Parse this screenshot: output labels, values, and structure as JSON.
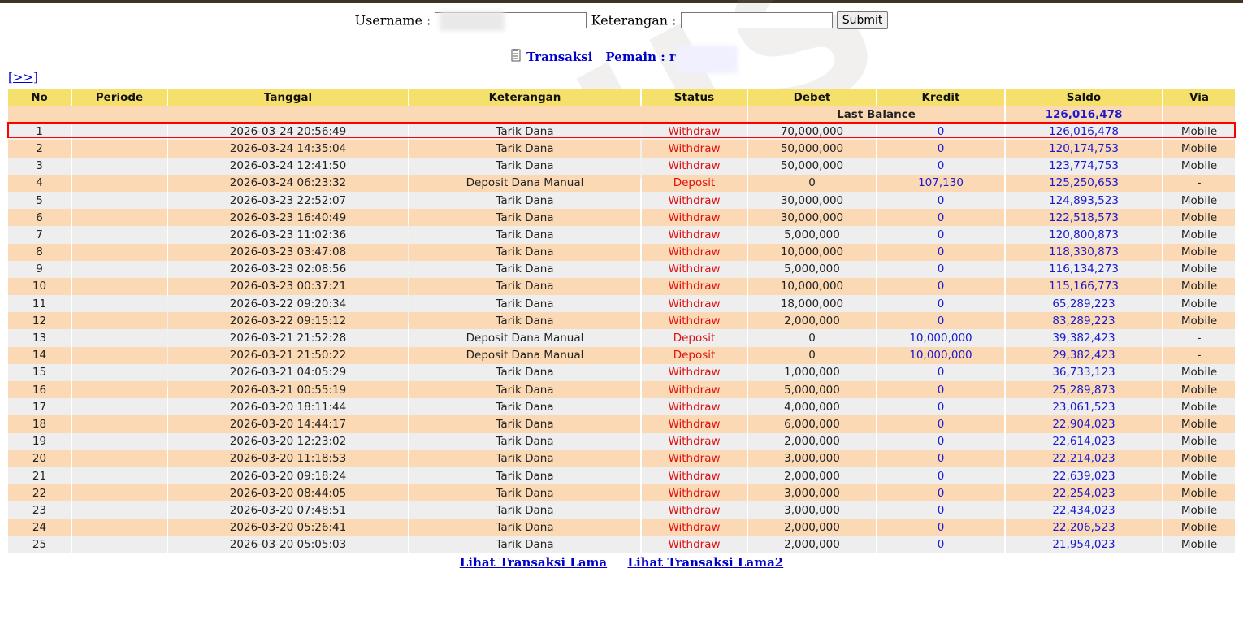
{
  "form": {
    "username_label": "Username :",
    "username_value": "",
    "keterangan_label": "Keterangan :",
    "keterangan_value": "",
    "submit_label": "Submit"
  },
  "title": {
    "icon": "document-icon",
    "transaksi": "Transaksi",
    "pemain_label": "Pemain : r"
  },
  "nav_link": "[>>]",
  "watermark": "BONUS",
  "columns": [
    "No",
    "Periode",
    "Tanggal",
    "Keterangan",
    "Status",
    "Debet",
    "Kredit",
    "Saldo",
    "Via"
  ],
  "last_balance": {
    "label": "Last Balance",
    "value": "126,016,478"
  },
  "rows": [
    {
      "no": "1",
      "periode": "",
      "tanggal": "2026-03-24 20:56:49",
      "keterangan": "Tarik Dana",
      "status": "Withdraw",
      "debet": "70,000,000",
      "kredit": "0",
      "saldo": "126,016,478",
      "via": "Mobile"
    },
    {
      "no": "2",
      "periode": "",
      "tanggal": "2026-03-24 14:35:04",
      "keterangan": "Tarik Dana",
      "status": "Withdraw",
      "debet": "50,000,000",
      "kredit": "0",
      "saldo": "120,174,753",
      "via": "Mobile"
    },
    {
      "no": "3",
      "periode": "",
      "tanggal": "2026-03-24 12:41:50",
      "keterangan": "Tarik Dana",
      "status": "Withdraw",
      "debet": "50,000,000",
      "kredit": "0",
      "saldo": "123,774,753",
      "via": "Mobile"
    },
    {
      "no": "4",
      "periode": "",
      "tanggal": "2026-03-24 06:23:32",
      "keterangan": "Deposit Dana Manual",
      "status": "Deposit",
      "debet": "0",
      "kredit": "107,130",
      "saldo": "125,250,653",
      "via": "-"
    },
    {
      "no": "5",
      "periode": "",
      "tanggal": "2026-03-23 22:52:07",
      "keterangan": "Tarik Dana",
      "status": "Withdraw",
      "debet": "30,000,000",
      "kredit": "0",
      "saldo": "124,893,523",
      "via": "Mobile"
    },
    {
      "no": "6",
      "periode": "",
      "tanggal": "2026-03-23 16:40:49",
      "keterangan": "Tarik Dana",
      "status": "Withdraw",
      "debet": "30,000,000",
      "kredit": "0",
      "saldo": "122,518,573",
      "via": "Mobile"
    },
    {
      "no": "7",
      "periode": "",
      "tanggal": "2026-03-23 11:02:36",
      "keterangan": "Tarik Dana",
      "status": "Withdraw",
      "debet": "5,000,000",
      "kredit": "0",
      "saldo": "120,800,873",
      "via": "Mobile"
    },
    {
      "no": "8",
      "periode": "",
      "tanggal": "2026-03-23 03:47:08",
      "keterangan": "Tarik Dana",
      "status": "Withdraw",
      "debet": "10,000,000",
      "kredit": "0",
      "saldo": "118,330,873",
      "via": "Mobile"
    },
    {
      "no": "9",
      "periode": "",
      "tanggal": "2026-03-23 02:08:56",
      "keterangan": "Tarik Dana",
      "status": "Withdraw",
      "debet": "5,000,000",
      "kredit": "0",
      "saldo": "116,134,273",
      "via": "Mobile"
    },
    {
      "no": "10",
      "periode": "",
      "tanggal": "2026-03-23 00:37:21",
      "keterangan": "Tarik Dana",
      "status": "Withdraw",
      "debet": "10,000,000",
      "kredit": "0",
      "saldo": "115,166,773",
      "via": "Mobile"
    },
    {
      "no": "11",
      "periode": "",
      "tanggal": "2026-03-22 09:20:34",
      "keterangan": "Tarik Dana",
      "status": "Withdraw",
      "debet": "18,000,000",
      "kredit": "0",
      "saldo": "65,289,223",
      "via": "Mobile"
    },
    {
      "no": "12",
      "periode": "",
      "tanggal": "2026-03-22 09:15:12",
      "keterangan": "Tarik Dana",
      "status": "Withdraw",
      "debet": "2,000,000",
      "kredit": "0",
      "saldo": "83,289,223",
      "via": "Mobile"
    },
    {
      "no": "13",
      "periode": "",
      "tanggal": "2026-03-21 21:52:28",
      "keterangan": "Deposit Dana Manual",
      "status": "Deposit",
      "debet": "0",
      "kredit": "10,000,000",
      "saldo": "39,382,423",
      "via": "-"
    },
    {
      "no": "14",
      "periode": "",
      "tanggal": "2026-03-21 21:50:22",
      "keterangan": "Deposit Dana Manual",
      "status": "Deposit",
      "debet": "0",
      "kredit": "10,000,000",
      "saldo": "29,382,423",
      "via": "-"
    },
    {
      "no": "15",
      "periode": "",
      "tanggal": "2026-03-21 04:05:29",
      "keterangan": "Tarik Dana",
      "status": "Withdraw",
      "debet": "1,000,000",
      "kredit": "0",
      "saldo": "36,733,123",
      "via": "Mobile"
    },
    {
      "no": "16",
      "periode": "",
      "tanggal": "2026-03-21 00:55:19",
      "keterangan": "Tarik Dana",
      "status": "Withdraw",
      "debet": "5,000,000",
      "kredit": "0",
      "saldo": "25,289,873",
      "via": "Mobile"
    },
    {
      "no": "17",
      "periode": "",
      "tanggal": "2026-03-20 18:11:44",
      "keterangan": "Tarik Dana",
      "status": "Withdraw",
      "debet": "4,000,000",
      "kredit": "0",
      "saldo": "23,061,523",
      "via": "Mobile"
    },
    {
      "no": "18",
      "periode": "",
      "tanggal": "2026-03-20 14:44:17",
      "keterangan": "Tarik Dana",
      "status": "Withdraw",
      "debet": "6,000,000",
      "kredit": "0",
      "saldo": "22,904,023",
      "via": "Mobile"
    },
    {
      "no": "19",
      "periode": "",
      "tanggal": "2026-03-20 12:23:02",
      "keterangan": "Tarik Dana",
      "status": "Withdraw",
      "debet": "2,000,000",
      "kredit": "0",
      "saldo": "22,614,023",
      "via": "Mobile"
    },
    {
      "no": "20",
      "periode": "",
      "tanggal": "2026-03-20 11:18:53",
      "keterangan": "Tarik Dana",
      "status": "Withdraw",
      "debet": "3,000,000",
      "kredit": "0",
      "saldo": "22,214,023",
      "via": "Mobile"
    },
    {
      "no": "21",
      "periode": "",
      "tanggal": "2026-03-20 09:18:24",
      "keterangan": "Tarik Dana",
      "status": "Withdraw",
      "debet": "2,000,000",
      "kredit": "0",
      "saldo": "22,639,023",
      "via": "Mobile"
    },
    {
      "no": "22",
      "periode": "",
      "tanggal": "2026-03-20 08:44:05",
      "keterangan": "Tarik Dana",
      "status": "Withdraw",
      "debet": "3,000,000",
      "kredit": "0",
      "saldo": "22,254,023",
      "via": "Mobile"
    },
    {
      "no": "23",
      "periode": "",
      "tanggal": "2026-03-20 07:48:51",
      "keterangan": "Tarik Dana",
      "status": "Withdraw",
      "debet": "3,000,000",
      "kredit": "0",
      "saldo": "22,434,023",
      "via": "Mobile"
    },
    {
      "no": "24",
      "periode": "",
      "tanggal": "2026-03-20 05:26:41",
      "keterangan": "Tarik Dana",
      "status": "Withdraw",
      "debet": "2,000,000",
      "kredit": "0",
      "saldo": "22,206,523",
      "via": "Mobile"
    },
    {
      "no": "25",
      "periode": "",
      "tanggal": "2026-03-20 05:05:03",
      "keterangan": "Tarik Dana",
      "status": "Withdraw",
      "debet": "2,000,000",
      "kredit": "0",
      "saldo": "21,954,023",
      "via": "Mobile"
    }
  ],
  "bottom_links": [
    "Lihat Transaksi Lama",
    "Lihat Transaksi Lama2"
  ],
  "colors": {
    "header_bg": "#f4e06a",
    "row_odd": "#eeeeee",
    "row_even": "#fbd9b4",
    "status": "#e01010",
    "link": "#0000cc",
    "highlight": "#ff0000"
  }
}
